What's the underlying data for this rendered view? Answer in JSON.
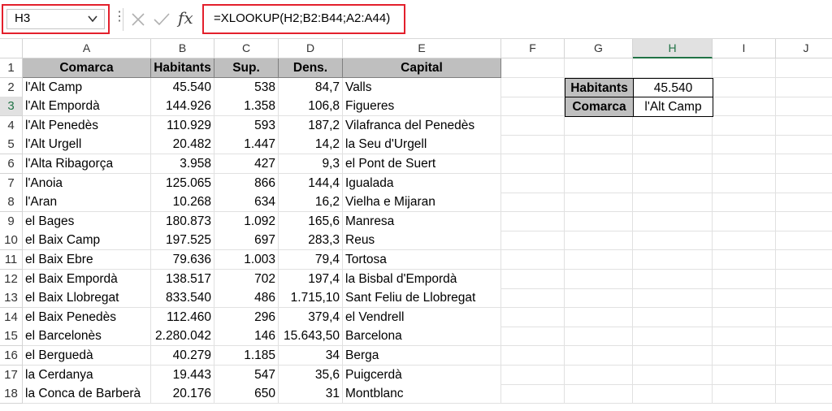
{
  "formula_bar": {
    "name_box": "H3",
    "formula": "=XLOOKUP(H2;B2:B44;A2:A44)",
    "fx_label": "fx",
    "menu_dots": "⋮"
  },
  "columns": [
    "A",
    "B",
    "C",
    "D",
    "E",
    "F",
    "G",
    "H",
    "I",
    "J"
  ],
  "rows": [
    "1",
    "2",
    "3",
    "4",
    "5",
    "6",
    "7",
    "8",
    "9",
    "10",
    "11",
    "12",
    "13",
    "14",
    "15",
    "16",
    "17",
    "18"
  ],
  "table": {
    "headers": [
      "Comarca",
      "Habitants",
      "Sup.",
      "Dens.",
      "Capital"
    ],
    "records": [
      [
        "l'Alt Camp",
        "45.540",
        "538",
        "84,7",
        "Valls"
      ],
      [
        "l'Alt Empordà",
        "144.926",
        "1.358",
        "106,8",
        "Figueres"
      ],
      [
        "l'Alt Penedès",
        "110.929",
        "593",
        "187,2",
        "Vilafranca del Penedès"
      ],
      [
        "l'Alt Urgell",
        "20.482",
        "1.447",
        "14,2",
        "la Seu d'Urgell"
      ],
      [
        "l'Alta Ribagorça",
        "3.958",
        "427",
        "9,3",
        "el Pont de Suert"
      ],
      [
        "l'Anoia",
        "125.065",
        "866",
        "144,4",
        "Igualada"
      ],
      [
        "l'Aran",
        "10.268",
        "634",
        "16,2",
        "Vielha e Mijaran"
      ],
      [
        "el Bages",
        "180.873",
        "1.092",
        "165,6",
        "Manresa"
      ],
      [
        "el Baix Camp",
        "197.525",
        "697",
        "283,3",
        "Reus"
      ],
      [
        "el Baix Ebre",
        "79.636",
        "1.003",
        "79,4",
        "Tortosa"
      ],
      [
        "el Baix Empordà",
        "138.517",
        "702",
        "197,4",
        "la Bisbal d'Empordà"
      ],
      [
        "el Baix Llobregat",
        "833.540",
        "486",
        "1.715,10",
        "Sant Feliu de Llobregat"
      ],
      [
        "el Baix Penedès",
        "112.460",
        "296",
        "379,4",
        "el Vendrell"
      ],
      [
        "el Barcelonès",
        "2.280.042",
        "146",
        "15.643,50",
        "Barcelona"
      ],
      [
        "el Berguedà",
        "40.279",
        "1.185",
        "34",
        "Berga"
      ],
      [
        "la Cerdanya",
        "19.443",
        "547",
        "35,6",
        "Puigcerdà"
      ],
      [
        "la Conca de Barberà",
        "20.176",
        "650",
        "31",
        "Montblanc"
      ]
    ]
  },
  "lookup": {
    "habitants_label": "Habitants",
    "habitants_value": "45.540",
    "comarca_label": "Comarca",
    "comarca_value": "l'Alt Camp"
  },
  "colors": {
    "highlight_border": "#e3202c",
    "header_fill": "#bfbfbf",
    "selection_accent": "#217346"
  }
}
